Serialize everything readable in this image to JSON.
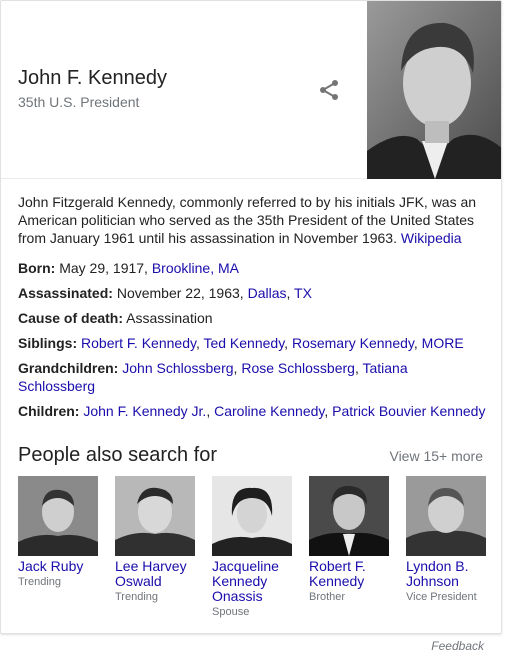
{
  "entity": {
    "name": "John F. Kennedy",
    "subtitle": "35th U.S. President"
  },
  "description": {
    "text": "John Fitzgerald Kennedy, commonly referred to by his initials JFK, was an American politician who served as the 35th President of the United States from January 1961 until his assassination in November 1963. ",
    "source": "Wikipedia"
  },
  "facts": {
    "born": {
      "label": "Born:",
      "text": "May 29, 1917, ",
      "link": "Brookline, MA"
    },
    "assassinated": {
      "label": "Assassinated:",
      "text": "November 22, 1963, ",
      "link1": "Dallas",
      "sep": ", ",
      "link2": "TX"
    },
    "cause": {
      "label": "Cause of death:",
      "text": "Assassination"
    },
    "siblings": {
      "label": "Siblings:",
      "items": [
        "Robert F. Kennedy",
        "Ted Kennedy",
        "Rosemary Kennedy",
        "MORE"
      ]
    },
    "grandchildren": {
      "label": "Grandchildren:",
      "items": [
        "John Schlossberg",
        "Rose Schlossberg",
        "Tatiana Schlossberg"
      ]
    },
    "children": {
      "label": "Children:",
      "items": [
        "John F. Kennedy Jr.",
        "Caroline Kennedy",
        "Patrick Bouvier Kennedy"
      ]
    }
  },
  "people_also_search": {
    "title": "People also search for",
    "view_more": "View 15+ more",
    "people": [
      {
        "name": "Jack Ruby",
        "caption": "Trending"
      },
      {
        "name": "Lee Harvey Oswald",
        "caption": "Trending"
      },
      {
        "name": "Jacqueline Kennedy Onassis",
        "caption": "Spouse"
      },
      {
        "name": "Robert F. Kennedy",
        "caption": "Brother"
      },
      {
        "name": "Lyndon B. Johnson",
        "caption": "Vice President"
      }
    ]
  },
  "feedback": "Feedback",
  "icons": {
    "share": "share-icon"
  },
  "colors": {
    "link": "#1a0dab",
    "muted": "#70757a",
    "text": "#222222"
  }
}
